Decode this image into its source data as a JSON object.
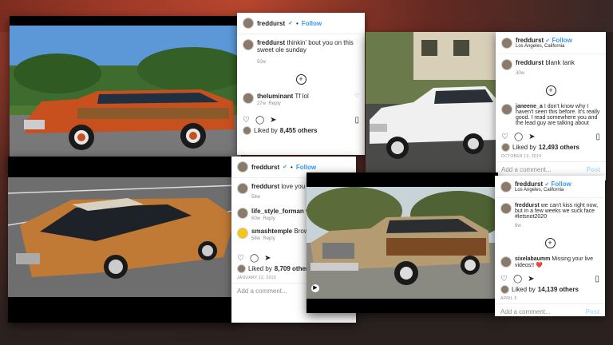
{
  "labels": {
    "liked_by": "Liked by ",
    "add_comment": "Add a comment...",
    "post": "Post"
  },
  "posts": [
    {
      "username": "freddurst",
      "follow": "Follow",
      "caption": "thinkin' bout you on this sweet ole sunday",
      "caption_time": "50w",
      "comment": {
        "user": "theluminant",
        "text": "Tf lol",
        "time": "27w"
      },
      "reply": "Reply",
      "liked_user": "8,455 others",
      "others": ""
    },
    {
      "username": "freddurst",
      "follow": "Follow",
      "location": "Los Angeles, California",
      "caption": "blank tank",
      "caption_time": "30w",
      "comment": {
        "user": "janeene_a",
        "text": "I don't know why I haven't seen this before. It's really good. I read somewhere you and the lead guy are talking about"
      },
      "likes": "12,493 others",
      "date": "OCTOBER 13, 2019"
    },
    {
      "username": "freddurst",
      "follow": "Follow",
      "caption": "love you",
      "caption_time": "58w",
      "comments": [
        {
          "user": "life_style_forman",
          "text": "ve",
          "time": "60w"
        },
        {
          "user": "smashtemple",
          "text": "Brown",
          "time": "58w"
        }
      ],
      "reply": "Reply",
      "likes": "8,709 others",
      "date": "JANUARY 12, 2019"
    },
    {
      "username": "freddurst",
      "follow": "Follow",
      "location": "Los Angeles, California",
      "caption": "we can't kiss right now, but in a few weeks we suck face #letsnot2020",
      "caption_time": "8w",
      "comment": {
        "user": "sixelabaumm",
        "text": "Missing your live videos!! ❤️"
      },
      "likes": "14,139 others",
      "date": "APRIL 5"
    }
  ]
}
